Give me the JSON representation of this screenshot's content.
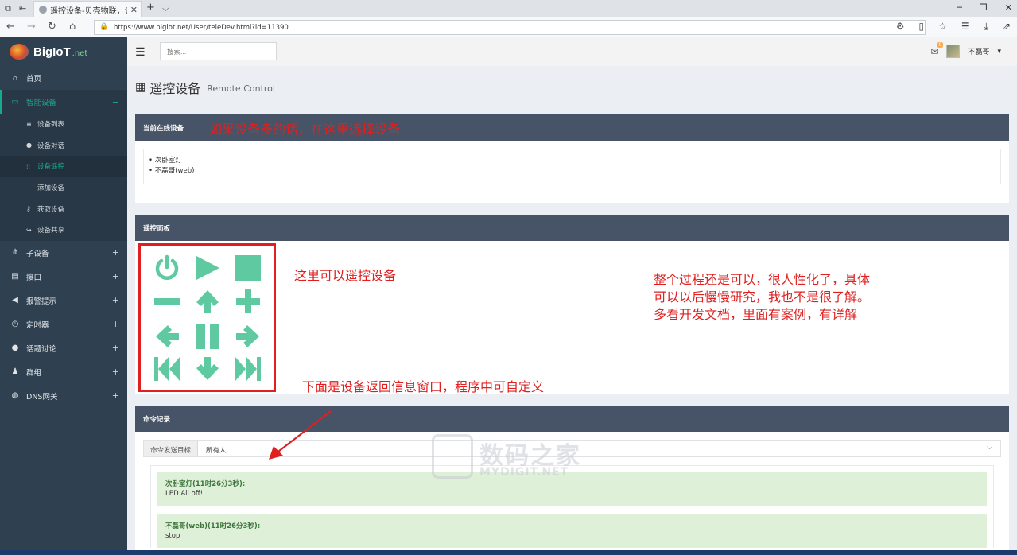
{
  "browser": {
    "tab_title": "遥控设备-贝壳物联，让",
    "url": "https://www.bigiot.net/User/teleDev.html?id=11390",
    "new_tab": "+",
    "tab_menu": "⌵"
  },
  "brand": {
    "name": "BigIoT",
    "suffix": ".net"
  },
  "sidebar": {
    "items": [
      {
        "label": "首页",
        "icon": "home-icon"
      },
      {
        "label": "智能设备",
        "icon": "laptop-icon",
        "toggle": "−"
      },
      {
        "label": "子设备",
        "icon": "sitemap-icon",
        "toggle": "+"
      },
      {
        "label": "接口",
        "icon": "chart-icon",
        "toggle": "+"
      },
      {
        "label": "报警提示",
        "icon": "volume-icon",
        "toggle": "+"
      },
      {
        "label": "定时器",
        "icon": "clock-icon",
        "toggle": "+"
      },
      {
        "label": "话题讨论",
        "icon": "comments-icon",
        "toggle": "+"
      },
      {
        "label": "群组",
        "icon": "users-icon",
        "toggle": "+"
      },
      {
        "label": "DNS网关",
        "icon": "globe-icon",
        "toggle": "+"
      }
    ],
    "subitems": [
      {
        "label": "设备列表"
      },
      {
        "label": "设备对话"
      },
      {
        "label": "设备遥控"
      },
      {
        "label": "添加设备"
      },
      {
        "label": "获取设备"
      },
      {
        "label": "设备共享"
      }
    ]
  },
  "topbar": {
    "search_placeholder": "搜索...",
    "mail_badge": "0",
    "username": "不磊哥"
  },
  "page": {
    "title": "遥控设备",
    "subtitle": "Remote Control"
  },
  "online_panel": {
    "header": "当前在线设备",
    "devices": [
      "次卧室灯",
      "不磊哥(web)"
    ]
  },
  "remote_panel": {
    "header": "遥控面板"
  },
  "log_panel": {
    "header": "命令记录",
    "target_label": "命令发送目标",
    "target_value": "所有人",
    "messages": [
      {
        "who": "次卧室灯(11时26分3秒):",
        "text": "LED All off!"
      },
      {
        "who": "不磊哥(web)(11时26分3秒):",
        "text": "stop"
      }
    ]
  },
  "annotations": {
    "select_device": "如果设备多的话，在这里选择设备",
    "remote_here": "这里可以遥控设备",
    "summary": [
      "整个过程还是可以，很人性化了，具体",
      "可以以后慢慢研究，我也不是很了解。",
      "多看开发文档，里面有案例，有详解"
    ],
    "return_window": "下面是设备返回信息窗口，程序中可自定义"
  },
  "watermark": {
    "cn": "数码之家",
    "en": "MYDIGIT.NET"
  },
  "colors": {
    "sidebar": "#2f4050",
    "accent": "#19aa8d",
    "remote_button": "#5fc9a2",
    "panel_header": "#475366",
    "annotation": "#e02020"
  }
}
